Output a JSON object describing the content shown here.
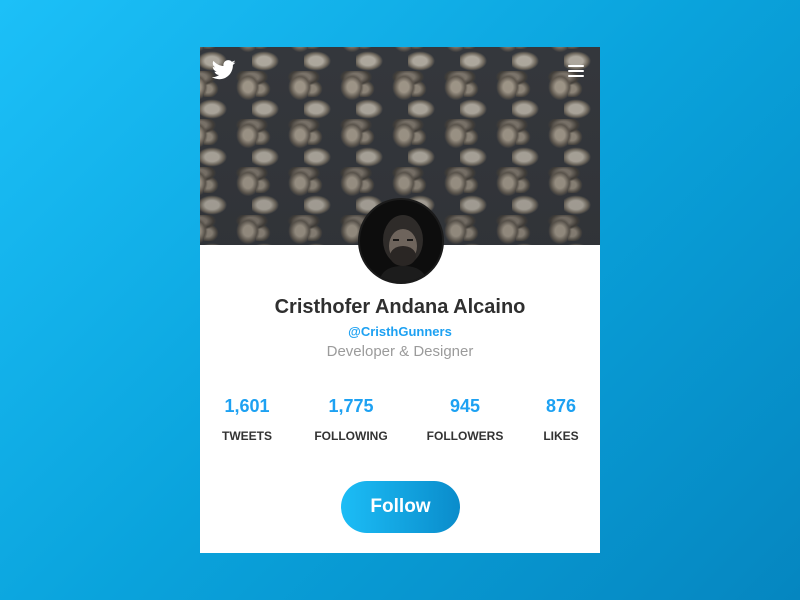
{
  "theme": {
    "accent": "#1da1f2",
    "background_start": "#1cc0f8",
    "background_end": "#0586c0"
  },
  "header": {
    "brand_icon": "twitter-bird-icon",
    "menu_icon": "hamburger-menu-icon"
  },
  "profile": {
    "name": "Cristhofer Andana Alcaino",
    "handle": "@CristhGunners",
    "bio": "Developer & Designer"
  },
  "stats": [
    {
      "value": "1,601",
      "label": "TWEETS"
    },
    {
      "value": "1,775",
      "label": "FOLLOWING"
    },
    {
      "value": "945",
      "label": "FOLLOWERS"
    },
    {
      "value": "876",
      "label": "LIKES"
    }
  ],
  "follow_button": {
    "label": "Follow"
  }
}
